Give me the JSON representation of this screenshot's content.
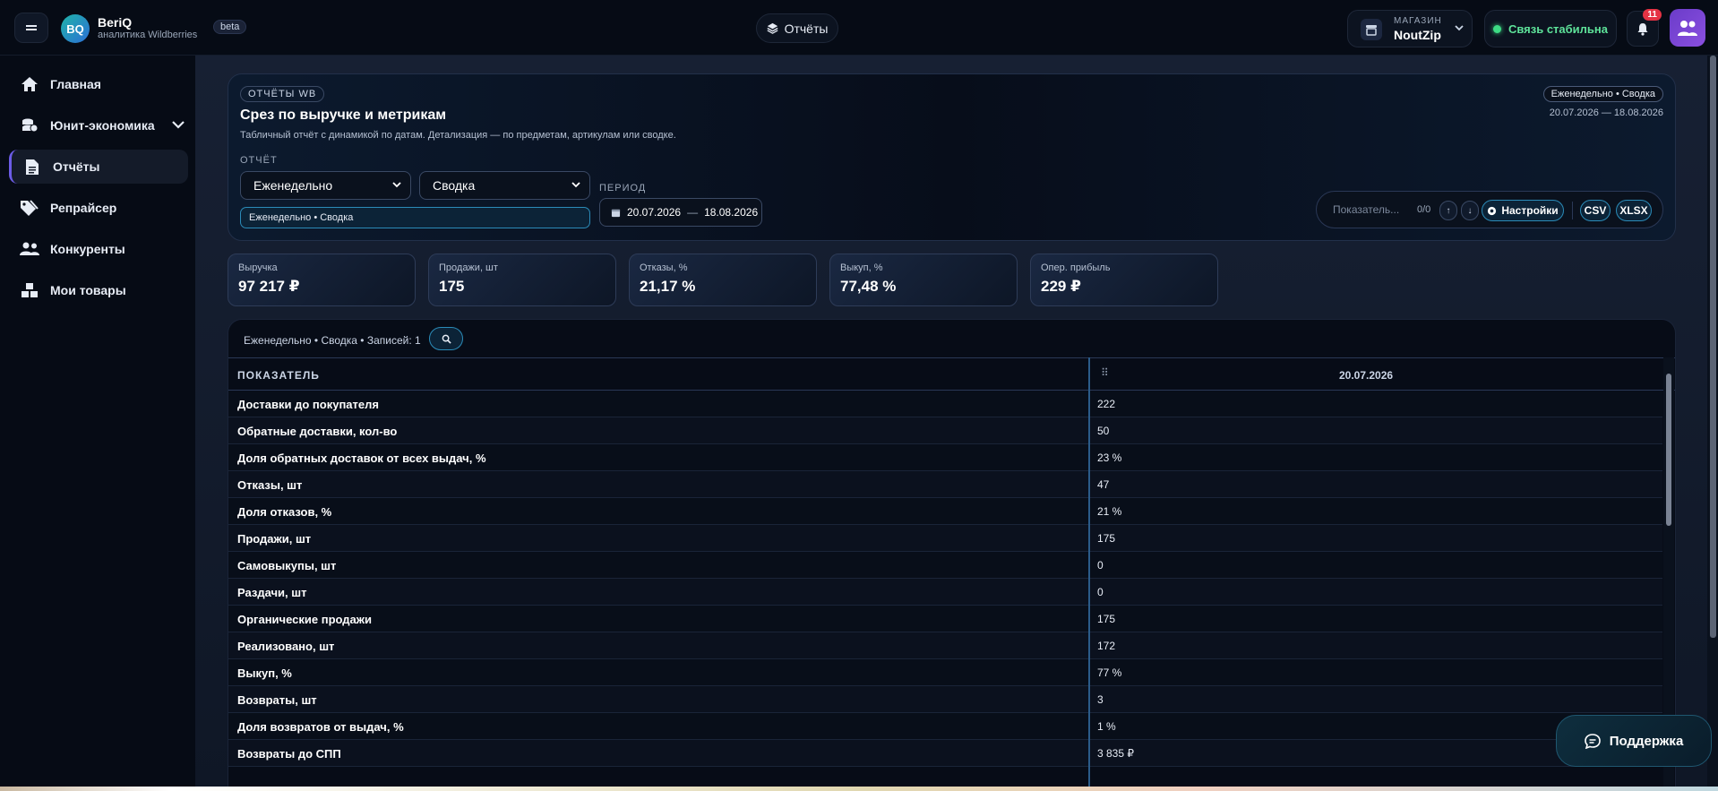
{
  "topbar": {
    "logo_initials": "BQ",
    "app_name": "BeriQ",
    "app_sub": "аналитика Wildberries",
    "beta": "beta",
    "reports_pill": "Отчёты",
    "store_label": "МАГАЗИН",
    "store_name": "NoutZip",
    "connection": "Связь стабильна",
    "notifications_count": "11"
  },
  "sidebar": {
    "items": [
      {
        "label": "Главная",
        "icon": "home-icon"
      },
      {
        "label": "Юнит-экономика",
        "icon": "coins-icon"
      },
      {
        "label": "Отчёты",
        "icon": "document-icon"
      },
      {
        "label": "Репрайсер",
        "icon": "tags-icon"
      },
      {
        "label": "Конкуренты",
        "icon": "users-icon"
      },
      {
        "label": "Мои товары",
        "icon": "boxes-icon"
      }
    ],
    "active": "Отчёты"
  },
  "hero": {
    "tag": "ОТЧЁТЫ WB",
    "title": "Срез по выручке и метрикам",
    "subtitle": "Табличный отчёт с динамикой по датам. Детализация — по предметам, артикулам или сводке.",
    "report_label": "ОТЧЁТ",
    "report_select": "Еженедельно",
    "mode_select": "Сводка",
    "chip": "Еженедельно • Сводка",
    "period_label": "ПЕРИОД",
    "date_from": "20.07.2026",
    "date_sep": "—",
    "date_to": "18.08.2026",
    "badge_right": "Еженедельно • Сводка",
    "range_right": "20.07.2026 — 18.08.2026"
  },
  "toolbar": {
    "search_placeholder": "Показатель...",
    "match_count": "0/0",
    "up": "↑",
    "down": "↓",
    "settings": "Настройки",
    "csv": "CSV",
    "xlsx": "XLSX"
  },
  "kpis": [
    {
      "label": "Выручка",
      "value": "97 217 ₽"
    },
    {
      "label": "Продажи, шт",
      "value": "175"
    },
    {
      "label": "Отказы, %",
      "value": "21,17 %"
    },
    {
      "label": "Выкуп, %",
      "value": "77,48 %"
    },
    {
      "label": "Опер. прибыль",
      "value": "229 ₽"
    }
  ],
  "table": {
    "meta": "Еженедельно • Сводка • Записей: 1",
    "col_metric": "ПОКАЗАТЕЛЬ",
    "col_date": "20.07.2026",
    "rows": [
      {
        "metric": "Доставки до покупателя",
        "value": "222"
      },
      {
        "metric": "Обратные доставки, кол-во",
        "value": "50"
      },
      {
        "metric": "Доля обратных доставок от всех выдач, %",
        "value": "23 %"
      },
      {
        "metric": "Отказы, шт",
        "value": "47"
      },
      {
        "metric": "Доля отказов, %",
        "value": "21 %"
      },
      {
        "metric": "Продажи, шт",
        "value": "175"
      },
      {
        "metric": "Самовыкупы, шт",
        "value": "0"
      },
      {
        "metric": "Раздачи, шт",
        "value": "0"
      },
      {
        "metric": "Органические продажи",
        "value": "175"
      },
      {
        "metric": "Реализовано, шт",
        "value": "172"
      },
      {
        "metric": "Выкуп, %",
        "value": "77 %"
      },
      {
        "metric": "Возвраты, шт",
        "value": "3"
      },
      {
        "metric": "Доля возвратов от выдач, %",
        "value": "1 %"
      },
      {
        "metric": "Возвраты до СПП",
        "value": "3 835 ₽"
      }
    ]
  },
  "support": "Поддержка"
}
